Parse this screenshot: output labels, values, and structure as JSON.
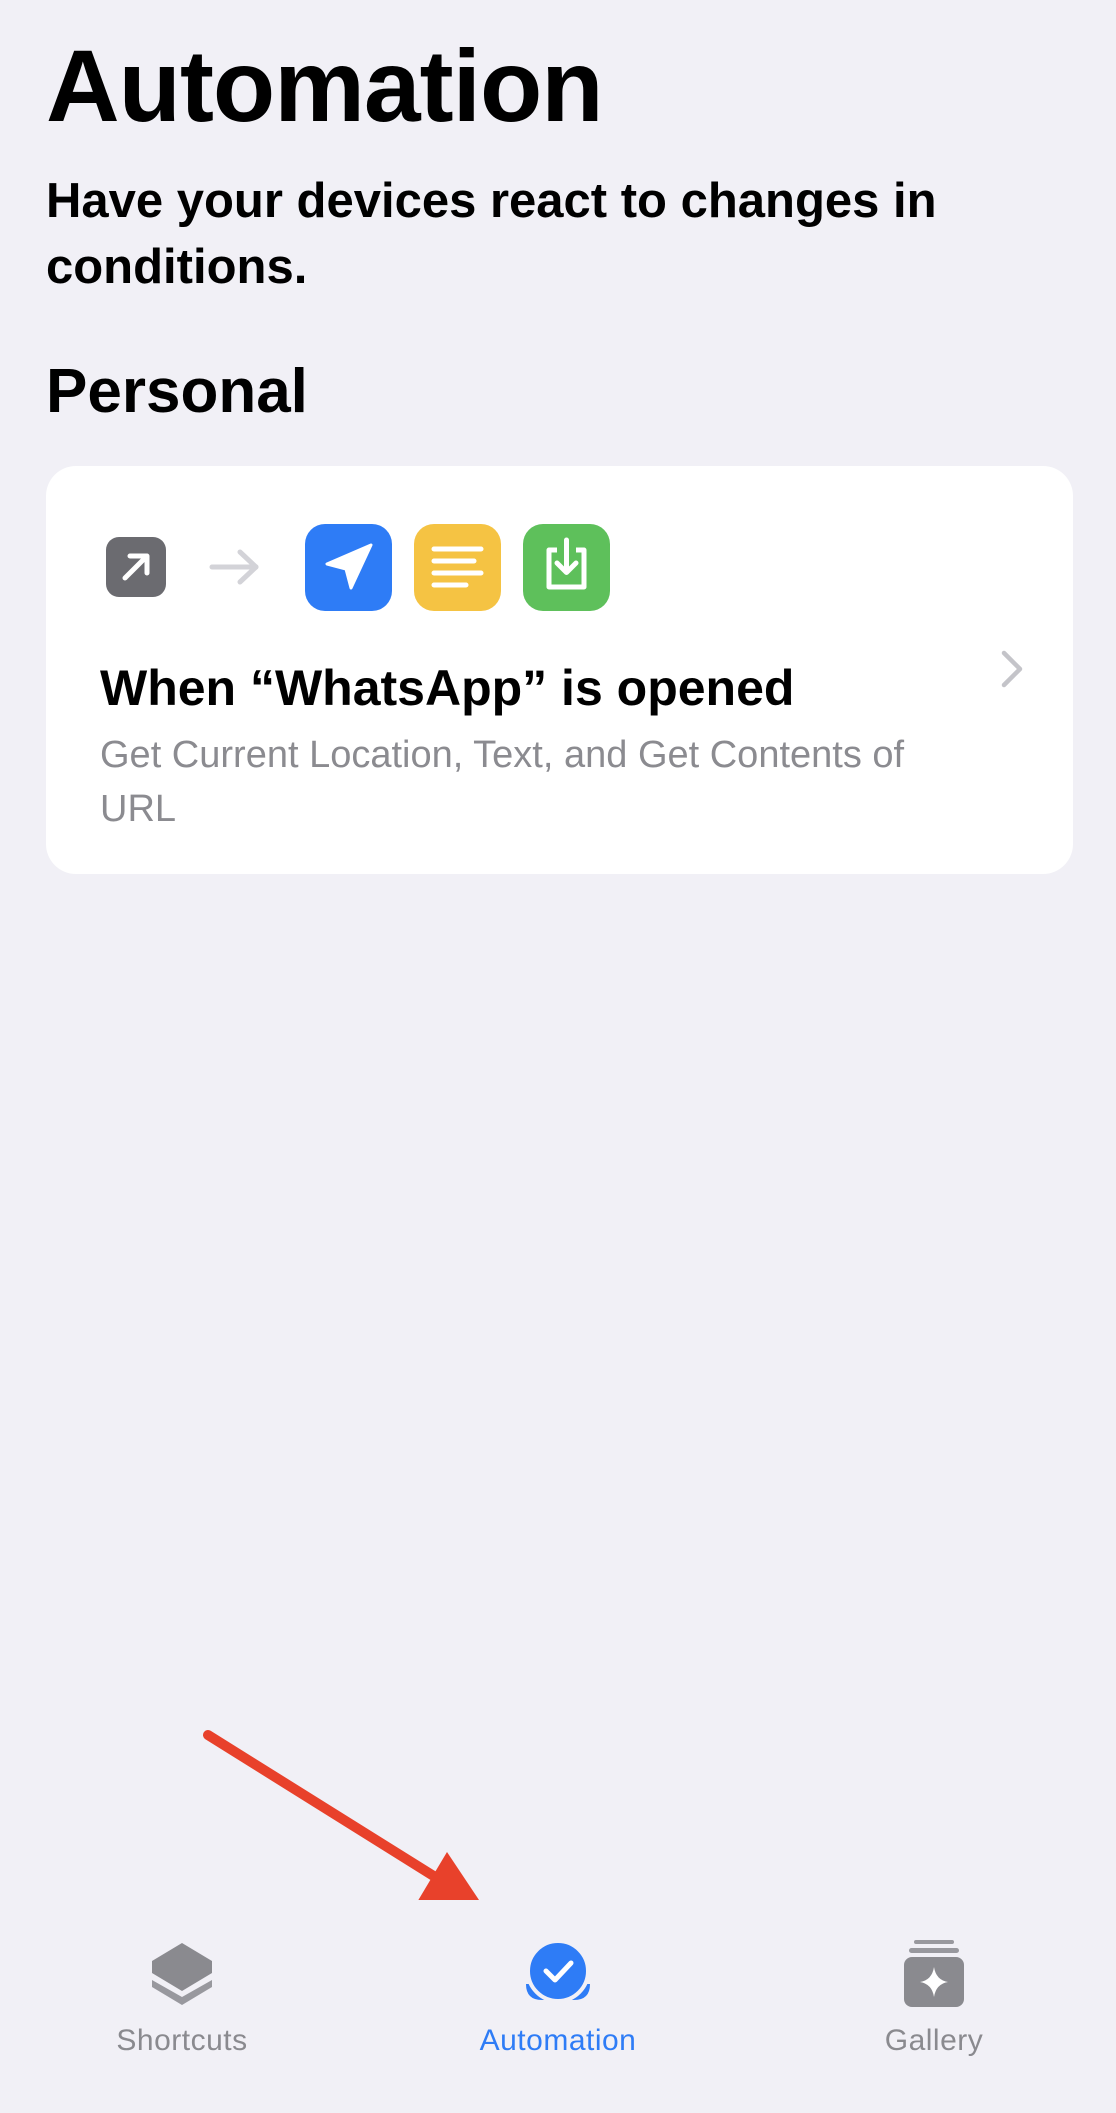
{
  "header": {
    "title": "Automation",
    "subtitle": "Have your devices react to changes in conditions."
  },
  "sections": [
    {
      "title": "Personal",
      "cards": [
        {
          "trigger_icon": "app-open-arrow-icon",
          "action_icons": [
            "location-arrow-icon",
            "text-lines-icon",
            "download-tray-icon"
          ],
          "title": "When “WhatsApp” is opened",
          "description": "Get Current Location, Text, and Get Contents of URL"
        }
      ]
    }
  ],
  "tab_bar": {
    "tabs": [
      {
        "label": "Shortcuts",
        "icon": "layers-icon",
        "active": false
      },
      {
        "label": "Automation",
        "icon": "automation-check-icon",
        "active": true
      },
      {
        "label": "Gallery",
        "icon": "gallery-sparkle-icon",
        "active": false
      }
    ]
  },
  "colors": {
    "background": "#f1f0f6",
    "accent": "#2e7cf6",
    "location_action": "#2e7cf6",
    "text_action": "#f5c343",
    "url_action": "#5ec05b",
    "trigger": "#6b6b70",
    "annotation_arrow": "#e8412b"
  }
}
